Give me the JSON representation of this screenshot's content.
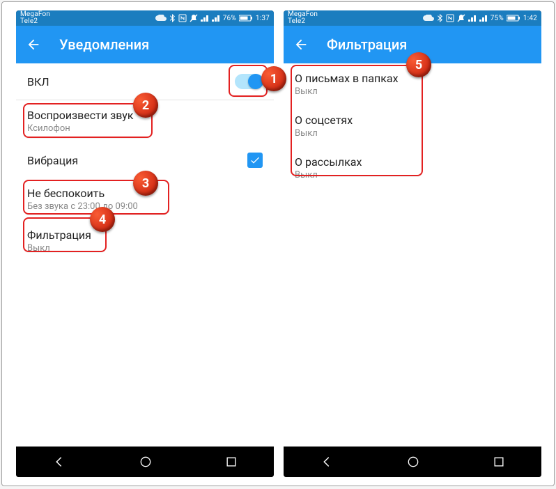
{
  "screens": {
    "left": {
      "statusbar": {
        "carrier1": "MegaFon",
        "carrier2": "Tele2",
        "battery": "76%",
        "time": "1:37"
      },
      "appbar": {
        "title": "Уведомления"
      },
      "rows": {
        "enable": {
          "title": "ВКЛ"
        },
        "sound": {
          "title": "Воспроизвести звук",
          "sub": "Ксилофон"
        },
        "vibration": {
          "title": "Вибрация"
        },
        "dnd": {
          "title": "Не беспокоить",
          "sub": "Без звука с 23:00 до 09:00"
        },
        "filter": {
          "title": "Фильтрация",
          "sub": "Выкл"
        }
      }
    },
    "right": {
      "statusbar": {
        "carrier1": "MegaFon",
        "carrier2": "Tele2",
        "battery": "75%",
        "time": "1:42"
      },
      "appbar": {
        "title": "Фильтрация"
      },
      "rows": {
        "folders": {
          "title": "О письмах в папках",
          "sub": "Выкл"
        },
        "socials": {
          "title": "О соцсетях",
          "sub": "Выкл"
        },
        "newsletters": {
          "title": "О рассылках",
          "sub": "Выкл"
        }
      }
    }
  },
  "annotations": {
    "b1": "1",
    "b2": "2",
    "b3": "3",
    "b4": "4",
    "b5": "5"
  }
}
